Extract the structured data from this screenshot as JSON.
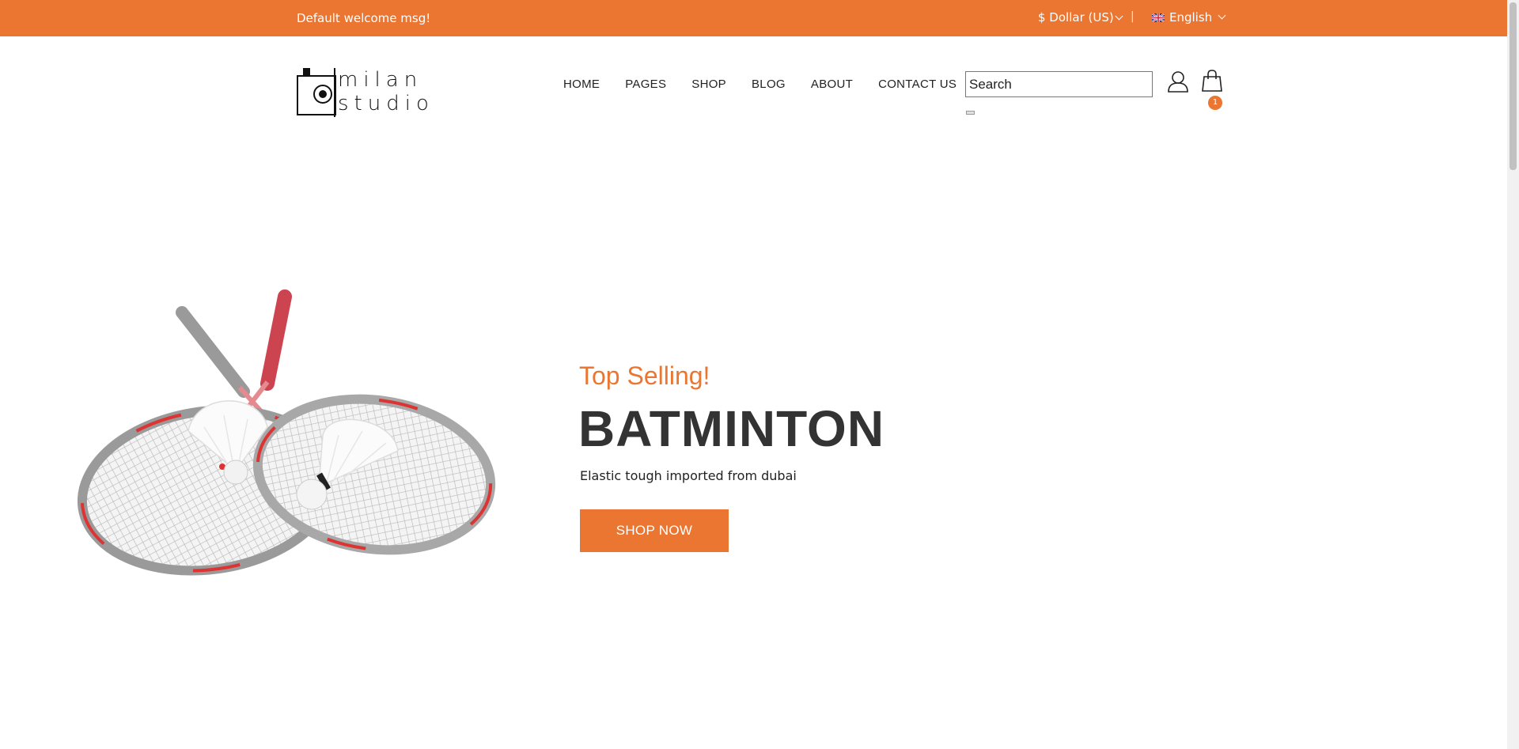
{
  "topbar": {
    "welcome": "Default welcome msg!",
    "currency": "$ Dollar (US)",
    "separator": "|",
    "language": "English"
  },
  "brand": {
    "line1": "milan",
    "line2": "studio"
  },
  "nav": [
    "HOME",
    "PAGES",
    "SHOP",
    "BLOG",
    "ABOUT",
    "CONTACT US"
  ],
  "search": {
    "value": "Search"
  },
  "cart": {
    "count": "1"
  },
  "hero": {
    "tag": "Top Selling!",
    "headline": "BATMINTON",
    "description": "Elastic tough imported from dubai",
    "button": "SHOP NOW"
  },
  "colors": {
    "accent": "#ea7631",
    "headline": "#333333"
  }
}
